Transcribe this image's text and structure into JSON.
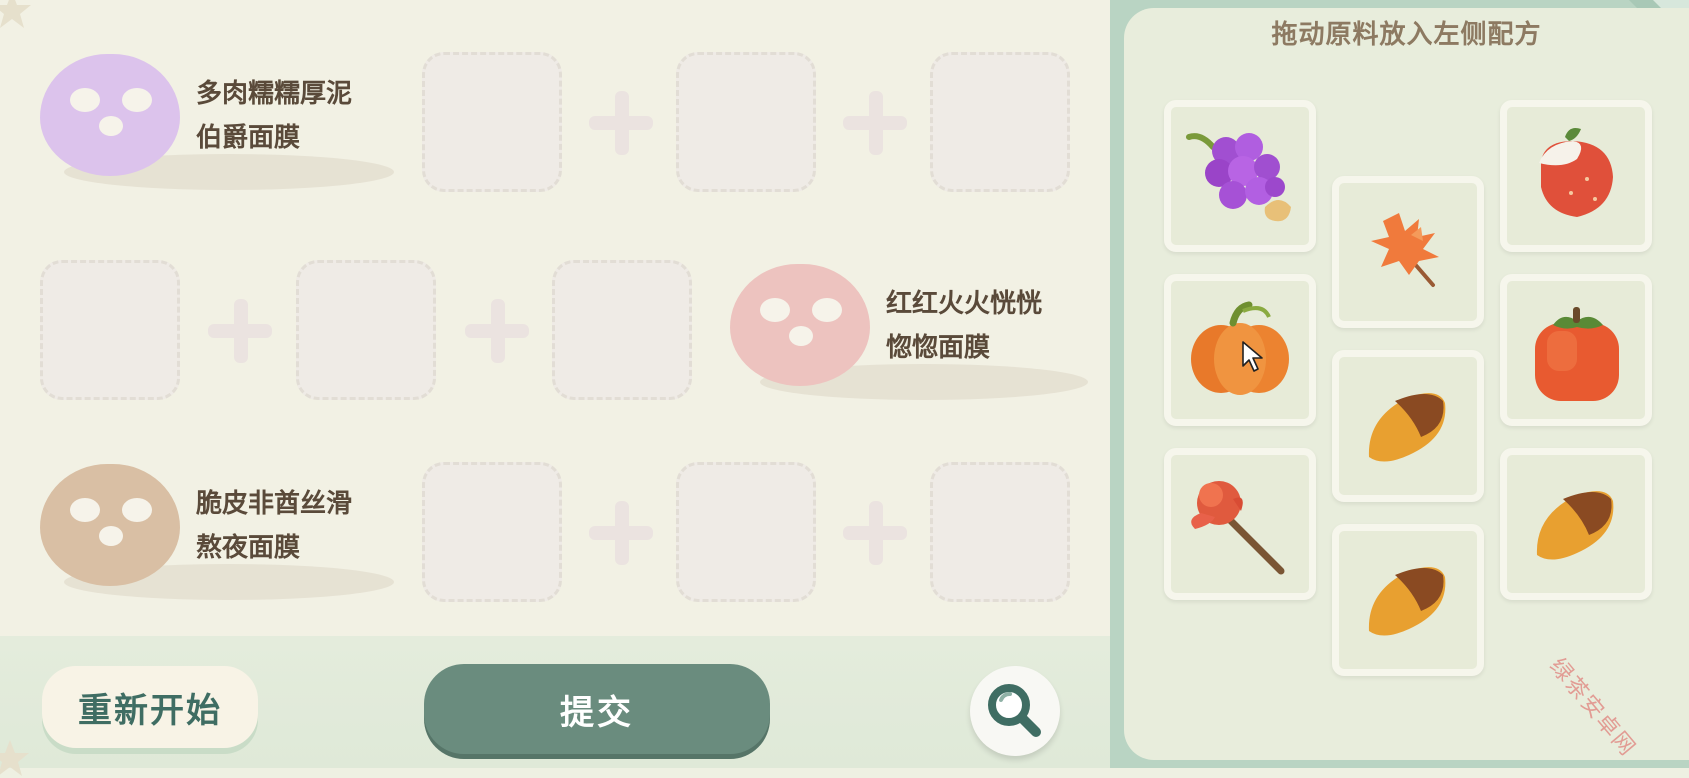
{
  "recipes": [
    {
      "mask_color": "#dcc3ec",
      "name_line1": "多肉糯糯厚泥",
      "name_line2": "伯爵面膜"
    },
    {
      "mask_color": "#edc3bf",
      "name_line1": "红红火火恍恍",
      "name_line2": "惚惚面膜"
    },
    {
      "mask_color": "#d9bfa4",
      "name_line1": "脆皮非酋丝滑",
      "name_line2": "熬夜面膜"
    }
  ],
  "buttons": {
    "restart_label": "重新开始",
    "submit_label": "提交"
  },
  "ingredient_panel": {
    "title": "拖动原料放入左侧配方",
    "items": [
      "grape",
      "maple-leaf",
      "strawberry",
      "pumpkin",
      "persimmon",
      "rose",
      "almond",
      "almond",
      "almond"
    ]
  },
  "watermark": "绿茶安卓网",
  "colors": {
    "submit": "#6a8c7e",
    "accent_text": "#3f6d63",
    "panel_border": "#b9d4c3"
  }
}
